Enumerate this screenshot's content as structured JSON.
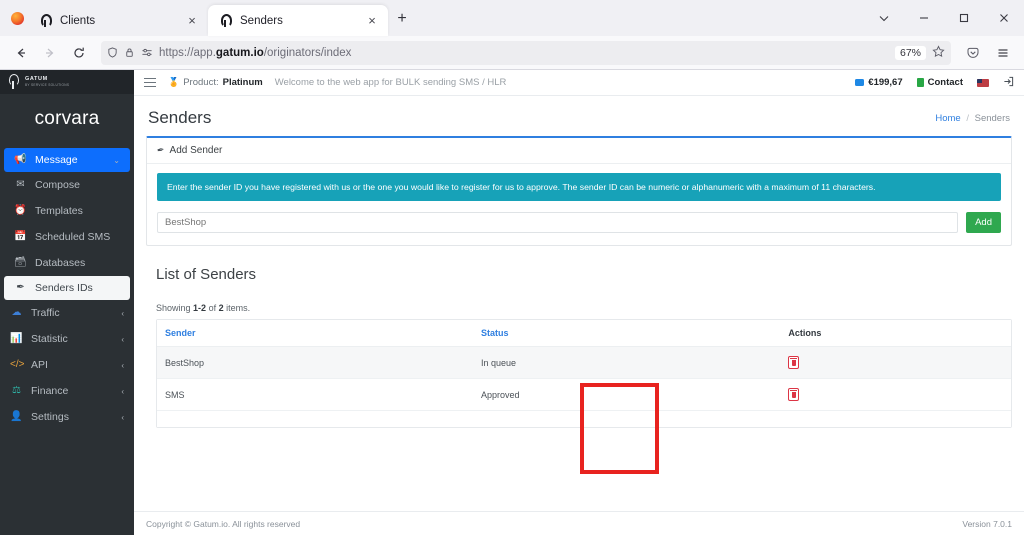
{
  "browser": {
    "tabs": [
      {
        "title": "Clients",
        "active": false,
        "favicon": "gatum-logo-icon"
      },
      {
        "title": "Senders",
        "active": true,
        "favicon": "gatum-logo-icon"
      }
    ],
    "new_tab_label": "+",
    "close_label": "×",
    "url": {
      "scheme": "https://app.",
      "domain": "gatum.io",
      "path": "/originators/index"
    },
    "zoom": "67%",
    "window_controls": {
      "minimize": "–",
      "maximize": "❐",
      "close": "×",
      "list_tabs": "⌄"
    }
  },
  "sidebar": {
    "logo": {
      "name": "GATUM",
      "tagline": "BY SERVICE SOLUTIONS"
    },
    "company": "corvara",
    "items": [
      {
        "label": "Message",
        "icon": "bullhorn-icon",
        "state": "active-blue",
        "chevron": "⌄"
      },
      {
        "label": "Compose",
        "icon": "envelope-icon",
        "state": "sub",
        "chevron": ""
      },
      {
        "label": "Templates",
        "icon": "clock-icon",
        "state": "sub",
        "chevron": ""
      },
      {
        "label": "Scheduled SMS",
        "icon": "calendar-icon",
        "state": "sub",
        "chevron": ""
      },
      {
        "label": "Databases",
        "icon": "database-icon",
        "state": "sub",
        "chevron": ""
      },
      {
        "label": "Senders IDs",
        "icon": "feather-icon",
        "state": "active-light",
        "chevron": ""
      },
      {
        "label": "Traffic",
        "icon": "traffic-icon",
        "state": "normal",
        "chevron": "‹"
      },
      {
        "label": "Statistic",
        "icon": "chart-icon",
        "state": "normal",
        "chevron": "‹"
      },
      {
        "label": "API",
        "icon": "code-icon",
        "state": "normal",
        "chevron": "‹"
      },
      {
        "label": "Finance",
        "icon": "finance-icon",
        "state": "normal",
        "chevron": "‹"
      },
      {
        "label": "Settings",
        "icon": "settings-icon",
        "state": "normal",
        "chevron": "‹"
      }
    ]
  },
  "topbar": {
    "product_prefix": "Product:",
    "product_name": "Platinum",
    "welcome": "Welcome to the web app for BULK sending SMS / HLR",
    "balance": "€199,67",
    "contact": "Contact",
    "language": "US",
    "logout": "→]"
  },
  "page": {
    "title": "Senders",
    "breadcrumb": {
      "home": "Home",
      "separator": "/",
      "current": "Senders"
    }
  },
  "add_sender": {
    "card_title": "Add Sender",
    "alert": "Enter the sender ID you have registered with us or the one you would like to register for us to approve. The sender ID can be numeric or alphanumeric with a maximum of 11 characters.",
    "input_value": "BestShop",
    "input_placeholder": "BestShop",
    "add_button": "Add"
  },
  "list": {
    "section_title": "List of Senders",
    "showing_prefix": "Showing",
    "showing_range": "1-2",
    "showing_middle": "of",
    "showing_total": "2",
    "showing_suffix": "items.",
    "columns": [
      "Sender",
      "Status",
      "Actions"
    ],
    "rows": [
      {
        "sender": "BestShop",
        "status": "In queue",
        "action_icon": "delete-icon"
      },
      {
        "sender": "SMS",
        "status": "Approved",
        "action_icon": "delete-icon"
      }
    ]
  },
  "annotation": {
    "target_column": "Status",
    "color": "#e8231f"
  },
  "footer": {
    "copyright": "Copyright © Gatum.io. All rights reserved",
    "version": "Version 7.0.1"
  },
  "colors": {
    "accent_blue": "#2f7fe0",
    "sidebar_bg": "#2b3034",
    "alert_teal": "#17a2b8",
    "add_green": "#2fa84f",
    "delete_red": "#dc3545",
    "highlight_red": "#e8231f"
  }
}
